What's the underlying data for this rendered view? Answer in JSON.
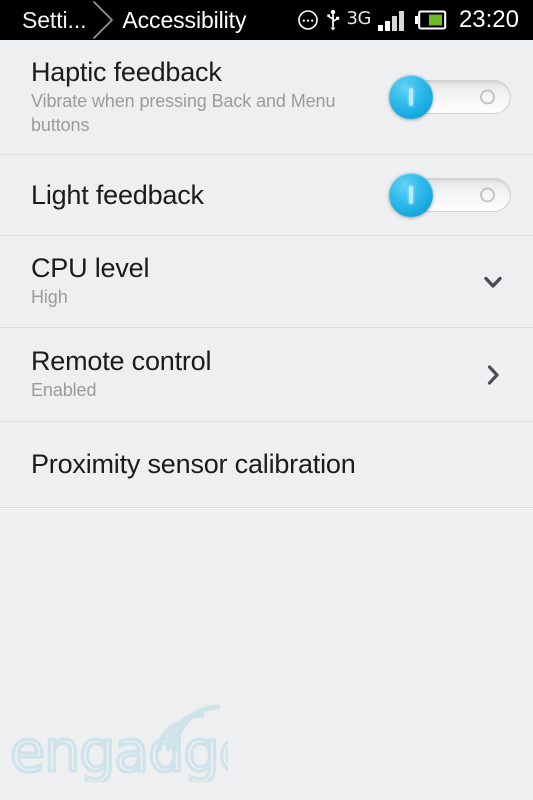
{
  "statusbar": {
    "breadcrumb_parent": "Setti...",
    "breadcrumb_current": "Accessibility",
    "network_label": "3G",
    "clock": "23:20",
    "icons": [
      "message-icon",
      "usb-icon",
      "network-3g-icon",
      "signal-bars-icon",
      "battery-icon"
    ],
    "background_color": "#000000",
    "text_color": "#ffffff"
  },
  "settings": {
    "rows": [
      {
        "title": "Haptic feedback",
        "subtitle": "Vibrate when pressing Back and Menu buttons",
        "accessory": "toggle",
        "toggle_state": "on",
        "toggle_on_label": "I",
        "toggle_off_label": "O"
      },
      {
        "title": "Light feedback",
        "subtitle": "",
        "accessory": "toggle",
        "toggle_state": "on",
        "toggle_on_label": "I",
        "toggle_off_label": "O"
      },
      {
        "title": "CPU level",
        "subtitle": "High",
        "accessory": "chevron-down",
        "toggle_state": "",
        "toggle_on_label": "",
        "toggle_off_label": ""
      },
      {
        "title": "Remote control",
        "subtitle": "Enabled",
        "accessory": "chevron-right",
        "toggle_state": "",
        "toggle_on_label": "",
        "toggle_off_label": ""
      },
      {
        "title": "Proximity sensor calibration",
        "subtitle": "",
        "accessory": "none",
        "toggle_state": "",
        "toggle_on_label": "",
        "toggle_off_label": ""
      }
    ]
  },
  "watermark": {
    "text": "engadget",
    "color": "#cfe3ea"
  },
  "colors": {
    "page_background": "#eeeff0",
    "row_background": "#eeeff0",
    "divider": "#dcdddf",
    "title_text": "#1b1b1b",
    "subtitle_text": "#9b9b9b",
    "toggle_accent": "#29b6e8",
    "battery_fill": "#6cbd2a"
  }
}
